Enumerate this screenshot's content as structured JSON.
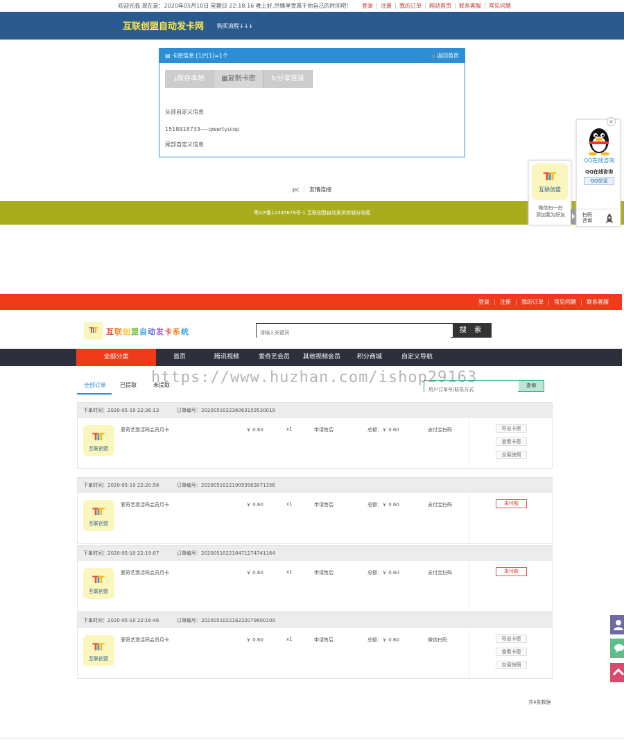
{
  "top": {
    "welcome": "欢迎光临 现在是：2020年05月10日 星期日 22:18:16 晚上好,尽情享受属于你自己的时间吧!",
    "links": [
      "登录",
      "注册",
      "我的订单",
      "网站首页",
      "联系客服",
      "常见问题"
    ],
    "site_name": "互联创盟自动发卡网",
    "flow": "购买流程↓↓↓"
  },
  "card": {
    "header": "卡密信息 [1]*[1]=1个",
    "back": "返回首页",
    "buttons": [
      "保存本地",
      "复制卡密",
      "分享连接"
    ],
    "head_info": "头部自定义信息",
    "secret": "1518918733----qwertyuiop",
    "tail_info": "尾部自定义信息"
  },
  "links1": [
    "pc",
    "友情连接"
  ],
  "footer1": "粤ICP备12345678号-1 互联创盟自动发货商城分站版",
  "wechat": {
    "logo": "互联创盟",
    "line1": "微信扫一扫",
    "line2": "添加我为好友"
  },
  "qq": {
    "close": "×",
    "online": "QQ在线咨询",
    "adv": "QQ在线咨询",
    "btn": "QQ交谈",
    "qr": "扫码咨询"
  },
  "page2": {
    "links": [
      "登录",
      "注册",
      "我的订单",
      "常见问题",
      "联系客服"
    ],
    "logo_text": [
      "互",
      "联",
      "创",
      "盟",
      "自",
      "动",
      "发",
      "卡",
      "系",
      "统"
    ],
    "logo_colors": [
      "#e84a3c",
      "#f08a24",
      "#f7c520",
      "#7bc043",
      "#3aa6dd",
      "#5b6ad0",
      "#a05ad8",
      "#e84a3c",
      "#f08a24",
      "#3aa6dd"
    ],
    "search_placeholder": "请输入关键词",
    "search_btn": "搜 索",
    "nav_all": "全部分类",
    "nav": [
      "首页",
      "腾讯视频",
      "爱奇艺会员",
      "其他视频会员",
      "积分商城",
      "自定义导航"
    ],
    "tabs": [
      "全部订单",
      "已提取",
      "未提取"
    ],
    "order_search_placeholder": "用户订单号/联系方式",
    "order_search_btn": "查询",
    "orders": [
      {
        "time": "下单时间：2020-05-10 22:36:13",
        "no": "订单编号：202005102236063159530019",
        "name": "爱奇艺激活码会员月卡",
        "price": "￥ 0.60",
        "qty": "x1",
        "after": "申请售后",
        "total": "总额：￥ 0.60",
        "pay": "支付宝扫码",
        "status": "paid",
        "actions": [
          "导出卡密",
          "查看卡密",
          "交易快照"
        ],
        "pic": "互联创盟"
      },
      {
        "time": "下单时间：2020-05-10 22:20:58",
        "no": "订单编号：202005102219093963071356",
        "name": "爱奇艺激活码会员月卡",
        "price": "￥ 0.60",
        "qty": "x1",
        "after": "申请售后",
        "total": "总额：￥ 0.60",
        "pay": "支付宝扫码",
        "status": "unpaid",
        "unpaid_label": "未付款",
        "pic": "互联创盟"
      },
      {
        "time": "下单时间：2020-05-10 22:19:07",
        "no": "订单编号：202005102218471274741164",
        "name": "爱奇艺激活码会员月卡",
        "price": "￥ 0.60",
        "qty": "x1",
        "after": "申请售后",
        "total": "总额：￥ 0.60",
        "pay": "支付宝扫码",
        "status": "unpaid",
        "unpaid_label": "未付款",
        "pic": "互联创盟"
      },
      {
        "time": "下单时间：2020-05-10 22:16:46",
        "no": "订单编号：202005102216232079600109",
        "name": "爱奇艺激活码会员月卡",
        "price": "￥ 0.60",
        "qty": "x1",
        "after": "申请售后",
        "total": "总额：￥ 0.60",
        "pay": "微信扫码",
        "status": "paid",
        "actions": [
          "导出卡密",
          "查看卡密",
          "交易快照"
        ],
        "pic": "互联创盟"
      }
    ],
    "total": "共4条数据"
  },
  "watermark": "https://www.huzhan.com/ishop29163",
  "colors": {
    "blue_header": "#2a5a8e",
    "accent_blue": "#2c8ed6",
    "olive_footer": "#a9ad1d",
    "red": "#ef3b1a",
    "dark_nav": "#2d2f3d"
  },
  "icons": {
    "card": "card-icon",
    "home": "home-icon",
    "save": "download-icon",
    "copy": "print-icon",
    "share": "share-icon",
    "qq": "qq-penguin-icon",
    "user": "user-icon",
    "chat": "chat-icon",
    "top": "arrow-up-icon"
  }
}
